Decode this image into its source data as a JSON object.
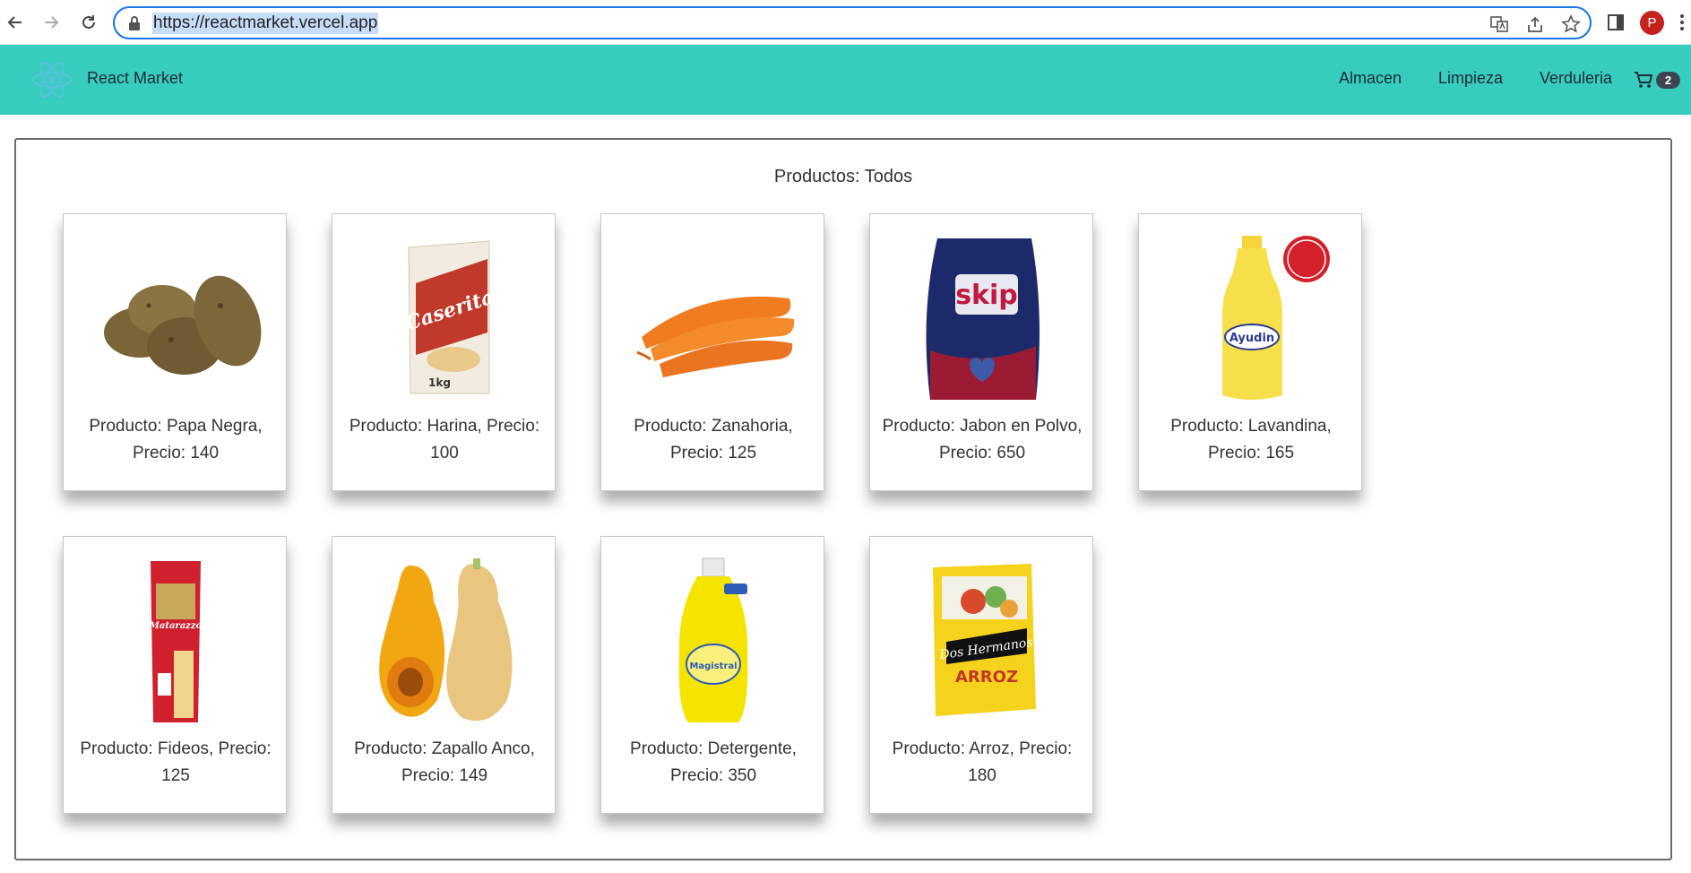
{
  "browser": {
    "url": "https://reactmarket.vercel.app",
    "profile_initial": "P"
  },
  "navbar": {
    "brand": "React Market",
    "links": [
      "Almacen",
      "Limpieza",
      "Verduleria"
    ],
    "cart_count": "2"
  },
  "section": {
    "title": "Productos: Todos"
  },
  "products": [
    {
      "caption": "Producto: Papa Negra, Precio: 140",
      "image": "potatoes",
      "image_text": ""
    },
    {
      "caption": "Producto: Harina, Precio: 100",
      "image": "flour-bag",
      "image_text": "Caserita"
    },
    {
      "caption": "Producto: Zanahoria, Precio: 125",
      "image": "carrots",
      "image_text": ""
    },
    {
      "caption": "Producto: Jabon en Polvo, Precio: 650",
      "image": "detergent-powder-bag",
      "image_text": "skip"
    },
    {
      "caption": "Producto: Lavandina, Precio: 165",
      "image": "bleach-bottle",
      "image_text": "Ayudin"
    },
    {
      "caption": "Producto: Fideos, Precio: 125",
      "image": "pasta-package",
      "image_text": "Matarazzo"
    },
    {
      "caption": "Producto: Zapallo Anco, Precio: 149",
      "image": "butternut-squash",
      "image_text": ""
    },
    {
      "caption": "Producto: Detergente, Precio: 350",
      "image": "dish-detergent-bottle",
      "image_text": "Magistral"
    },
    {
      "caption": "Producto: Arroz, Precio: 180",
      "image": "rice-box",
      "image_text": "Dos Hermanos"
    }
  ],
  "colors": {
    "navbar": "#37cdbe",
    "badge": "#3d4451",
    "profile": "#c5221f",
    "focus": "#1a73e8"
  }
}
